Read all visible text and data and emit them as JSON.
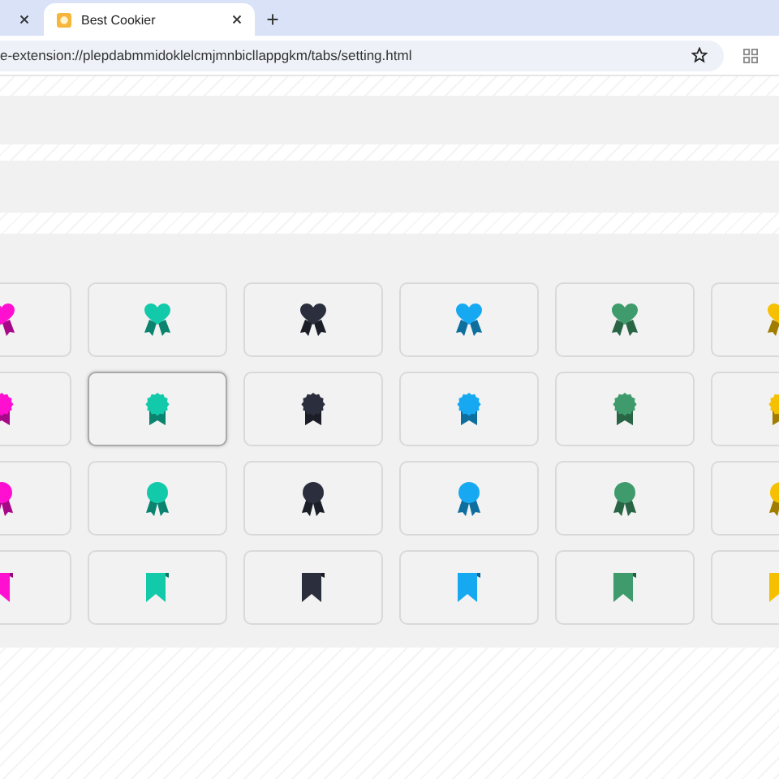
{
  "browser": {
    "tabs": [
      {
        "selected": false
      },
      {
        "title": "Best Cookier",
        "selected": true
      }
    ],
    "url": "e-extension://plepdabmmidoklelcmjmnbicllappgkm/tabs/setting.html"
  },
  "icon_grid": {
    "rows": [
      {
        "kind": "heart-ribbon",
        "cells": [
          {
            "color": "#ff0fd0",
            "selected": false
          },
          {
            "color": "#12c9a9",
            "selected": false
          },
          {
            "color": "#2b2f3d",
            "selected": false
          },
          {
            "color": "#16a9f2",
            "selected": false
          },
          {
            "color": "#3f9b6b",
            "selected": false
          },
          {
            "color": "#f6c000",
            "selected": false
          }
        ]
      },
      {
        "kind": "seal-ribbon",
        "cells": [
          {
            "color": "#ff0fd0",
            "selected": false
          },
          {
            "color": "#12c9a9",
            "selected": true
          },
          {
            "color": "#2b2f3d",
            "selected": false
          },
          {
            "color": "#16a9f2",
            "selected": false
          },
          {
            "color": "#3f9b6b",
            "selected": false
          },
          {
            "color": "#f6c000",
            "selected": false
          }
        ]
      },
      {
        "kind": "round-ribbon",
        "cells": [
          {
            "color": "#ff0fd0",
            "selected": false
          },
          {
            "color": "#12c9a9",
            "selected": false
          },
          {
            "color": "#2b2f3d",
            "selected": false
          },
          {
            "color": "#16a9f2",
            "selected": false
          },
          {
            "color": "#3f9b6b",
            "selected": false
          },
          {
            "color": "#f6c000",
            "selected": false
          }
        ]
      },
      {
        "kind": "bookmark",
        "cells": [
          {
            "color": "#ff0fd0",
            "selected": false
          },
          {
            "color": "#12c9a9",
            "selected": false
          },
          {
            "color": "#2b2f3d",
            "selected": false
          },
          {
            "color": "#16a9f2",
            "selected": false
          },
          {
            "color": "#3f9b6b",
            "selected": false
          },
          {
            "color": "#f6c000",
            "selected": false
          }
        ]
      }
    ]
  }
}
